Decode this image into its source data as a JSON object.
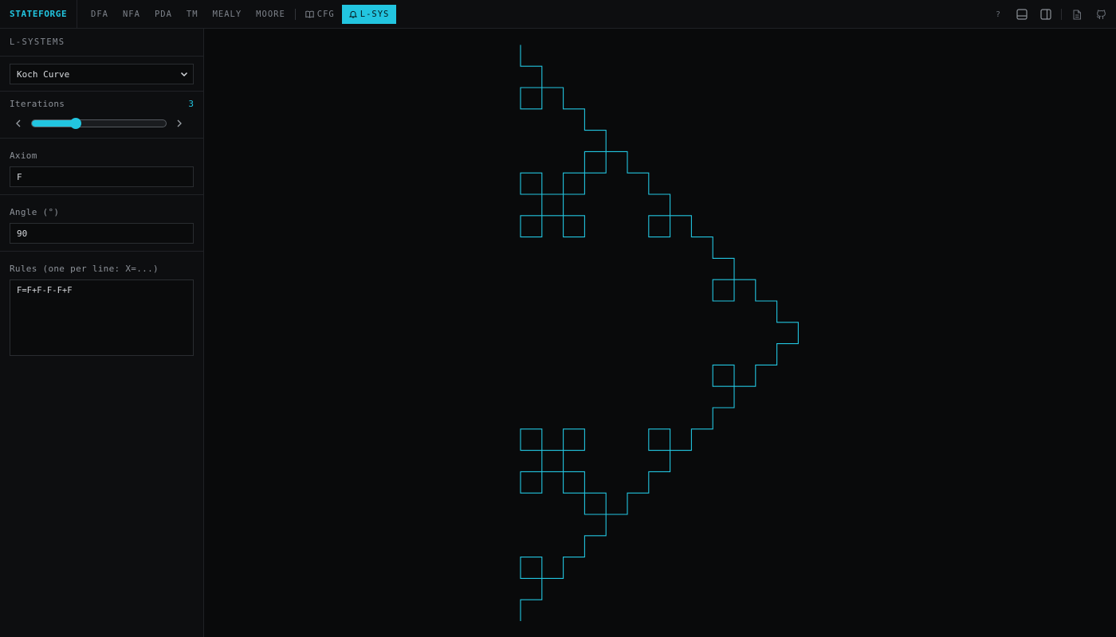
{
  "app": {
    "brand": "STATEFORGE"
  },
  "nav": {
    "items": [
      {
        "label": "DFA"
      },
      {
        "label": "NFA"
      },
      {
        "label": "PDA"
      },
      {
        "label": "TM"
      },
      {
        "label": "MEALY"
      },
      {
        "label": "MOORE"
      }
    ],
    "cfg": {
      "label": "CFG",
      "icon": "book-icon"
    },
    "lsys": {
      "label": "L-SYS",
      "icon": "bell-icon",
      "active": true
    }
  },
  "toolbar": {
    "help_label": "?"
  },
  "sidebar": {
    "title": "L-SYSTEMS",
    "preset": {
      "value": "Koch Curve"
    },
    "iterations": {
      "label": "Iterations",
      "value": "3",
      "fraction": 0.33
    },
    "axiom": {
      "label": "Axiom",
      "value": "F"
    },
    "angle": {
      "label": "Angle (°)",
      "value": "90"
    },
    "rules": {
      "label": "Rules (one per line: X=...)",
      "value": "F=F+F-F-F+F"
    }
  },
  "lsystem": {
    "axiom": "F",
    "angle_deg": 90,
    "iterations": 3,
    "rule": "F+F-F-F+F",
    "stroke_color": "#22c5e0"
  },
  "colors": {
    "accent": "#22c5e0",
    "background": "#090a0b",
    "panel": "#0d0e10"
  }
}
